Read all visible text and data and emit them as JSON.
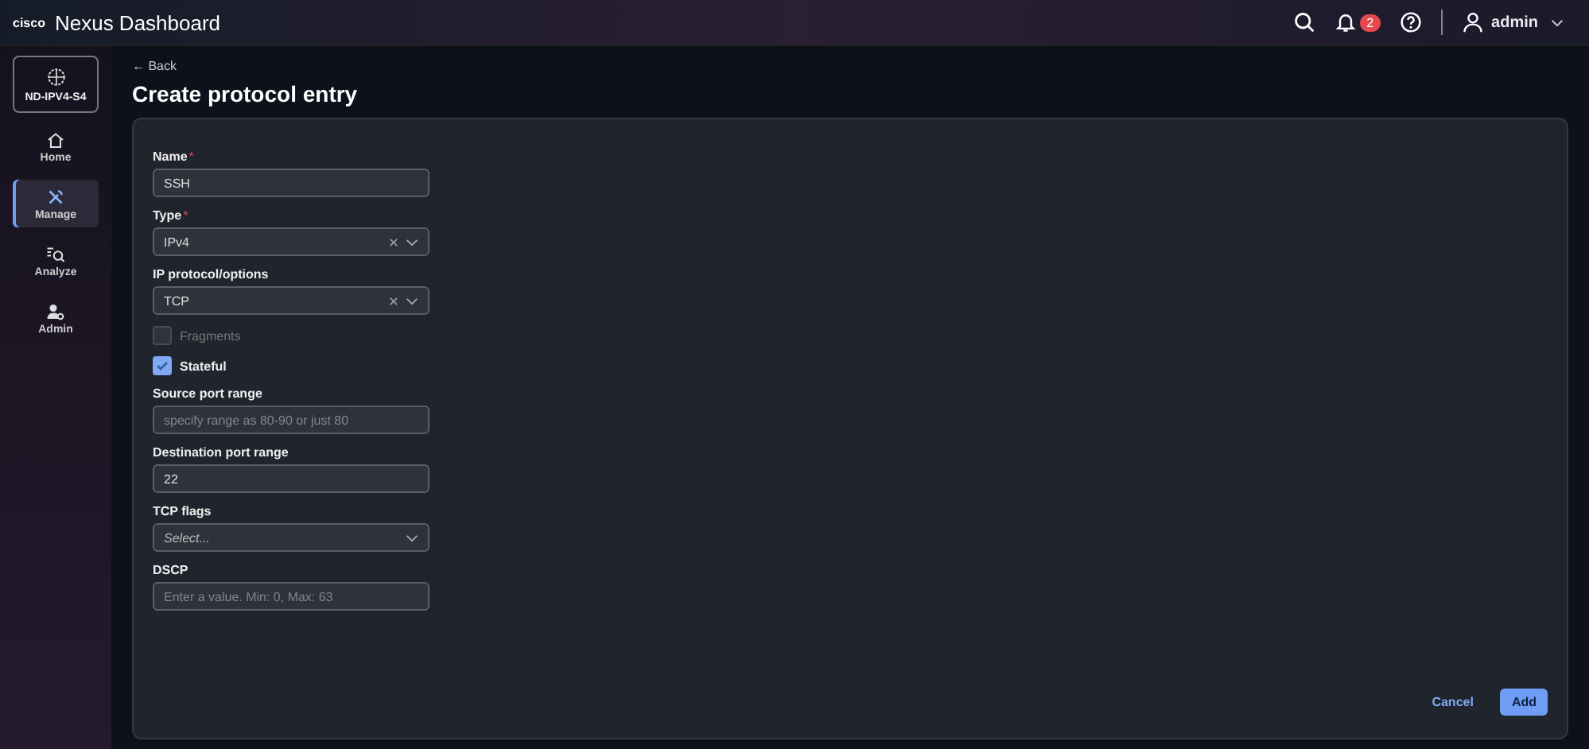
{
  "header": {
    "brand": "cisco",
    "title": "Nexus Dashboard",
    "notifications": "2",
    "user": "admin"
  },
  "sidebar": {
    "site": "ND-IPV4-S4",
    "items": [
      {
        "label": "Home",
        "selected": false
      },
      {
        "label": "Manage",
        "selected": true
      },
      {
        "label": "Analyze",
        "selected": false
      },
      {
        "label": "Admin",
        "selected": false
      }
    ]
  },
  "back": "← Back",
  "title": "Create protocol entry",
  "fields": [
    {
      "kind": "text",
      "label": "Name",
      "asterisk": "*",
      "value": "SSH"
    },
    {
      "kind": "select",
      "label": "Type",
      "asterisk": "*",
      "value": "IPv4",
      "clearable": true
    },
    {
      "kind": "select",
      "label": "IP protocol/options",
      "value": "TCP",
      "clearable": true
    },
    {
      "kind": "checkbox",
      "label": "Fragments",
      "checked": false,
      "disabled": true
    },
    {
      "kind": "checkbox",
      "label": "Stateful",
      "checked": true,
      "disabled": false
    },
    {
      "kind": "text",
      "label": "Source port range",
      "placeholder": "specify range as 80-90 or just 80"
    },
    {
      "kind": "text",
      "label": "Destination port range",
      "value": "22"
    },
    {
      "kind": "select",
      "label": "TCP flags",
      "placeholder": "Select...",
      "clearable": false
    },
    {
      "kind": "text",
      "label": "DSCP",
      "placeholder": "Enter a value. Min: 0, Max: 63"
    }
  ],
  "buttons": {
    "cancel": "Cancel",
    "submit": "Add"
  }
}
